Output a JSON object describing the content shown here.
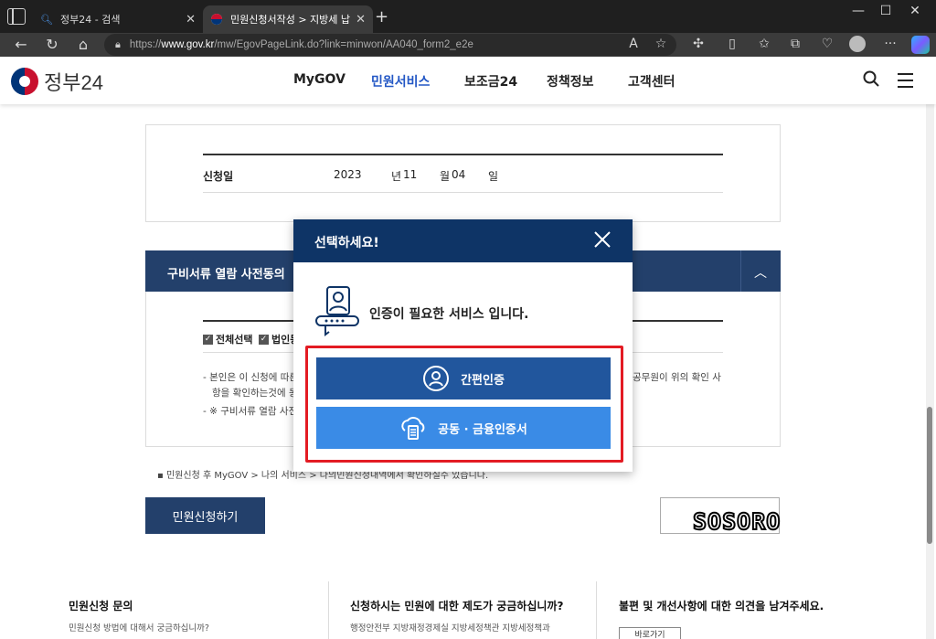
{
  "browser": {
    "tabs": [
      {
        "title": "정부24 - 검색"
      },
      {
        "title": "민원신청서작성 > 지방세 납세증"
      }
    ],
    "url_prefix": "https://",
    "url_host": "www.gov.kr",
    "url_path": "/mw/EgovPageLink.do?link=minwon/AA040_form2_e2e"
  },
  "site": {
    "logo_text": "정부24",
    "nav": [
      "MyGOV",
      "민원서비스",
      "보조금24",
      "정책정보",
      "고객센터"
    ],
    "active_nav": "민원서비스"
  },
  "form": {
    "date_label": "신청일",
    "year": "2023",
    "year_unit": "년",
    "month": "11",
    "month_unit": "월",
    "day": "04",
    "day_unit": "일"
  },
  "consent": {
    "title": "구비서류 열람 사전동의",
    "checkbox_all": "전체선택",
    "checkbox_corp": "법인동",
    "bullet1_left": "본인은 이 신청에 따른",
    "bullet1_right": "공무원이 위의 확인 사",
    "bullet1_line2": "항을 확인하는것에 동의",
    "bullet2": "※ 구비서류 열람 사전동"
  },
  "notice": "민원신청 후 MyGOV > 나의 서비스 > 나의민원신청내역에서 확인하실수 있습니다.",
  "apply_button": "민원신청하기",
  "watermark": "SOSORO",
  "footer": [
    {
      "title": "민원신청 문의",
      "sub": "민원신청 방법에 대해서 궁금하십니까?"
    },
    {
      "title": "신청하시는 민원에 대한 제도가 궁금하십니까?",
      "sub": "행정안전부 지방재정경제실 지방세정책관 지방세정책과"
    },
    {
      "title": "불편 및 개선사항에 대한 의견을 남겨주세요.",
      "sub": "",
      "button": "바로가기"
    }
  ],
  "modal": {
    "title": "선택하세요!",
    "message": "인증이 필요한 서비스 입니다.",
    "btn_simple": "간편인증",
    "btn_cert": "공동 · 금융인증서"
  },
  "colors": {
    "modal_header": "#0e3466",
    "btn_simple": "#21569d",
    "btn_cert": "#3a8be6",
    "highlight": "#e31b23",
    "section_bar": "#23406b"
  }
}
